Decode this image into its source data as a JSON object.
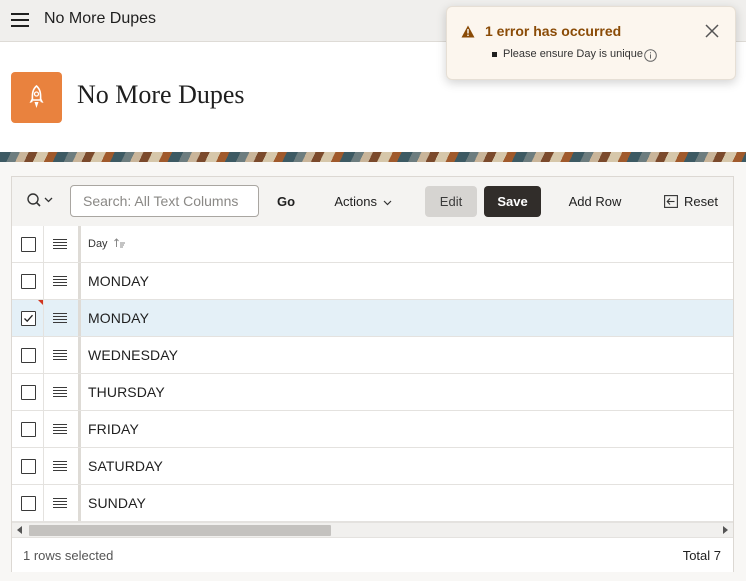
{
  "app": {
    "title": "No More Dupes",
    "menu_icon": "hamburger-icon",
    "logo_icon": "rocket-icon",
    "brand_color": "#e9823e"
  },
  "page": {
    "title": "No More Dupes"
  },
  "toolbar": {
    "search_placeholder": "Search: All Text Columns",
    "go_label": "Go",
    "actions_label": "Actions",
    "edit_label": "Edit",
    "save_label": "Save",
    "add_row_label": "Add Row",
    "reset_label": "Reset"
  },
  "grid": {
    "columns": [
      {
        "label": "Day",
        "sorted": "ascending"
      }
    ],
    "rows": [
      {
        "day": "MONDAY",
        "checked": false,
        "error": false
      },
      {
        "day": "MONDAY",
        "checked": true,
        "error": true
      },
      {
        "day": "WEDNESDAY",
        "checked": false,
        "error": false
      },
      {
        "day": "THURSDAY",
        "checked": false,
        "error": false
      },
      {
        "day": "FRIDAY",
        "checked": false,
        "error": false
      },
      {
        "day": "SATURDAY",
        "checked": false,
        "error": false
      },
      {
        "day": "SUNDAY",
        "checked": false,
        "error": false
      }
    ]
  },
  "footer": {
    "selected_text": "1 rows selected",
    "total_text": "Total 7"
  },
  "notification": {
    "title": "1 error has occurred",
    "messages": [
      "Please ensure Day is unique"
    ],
    "accent_color": "#8a4b06"
  }
}
